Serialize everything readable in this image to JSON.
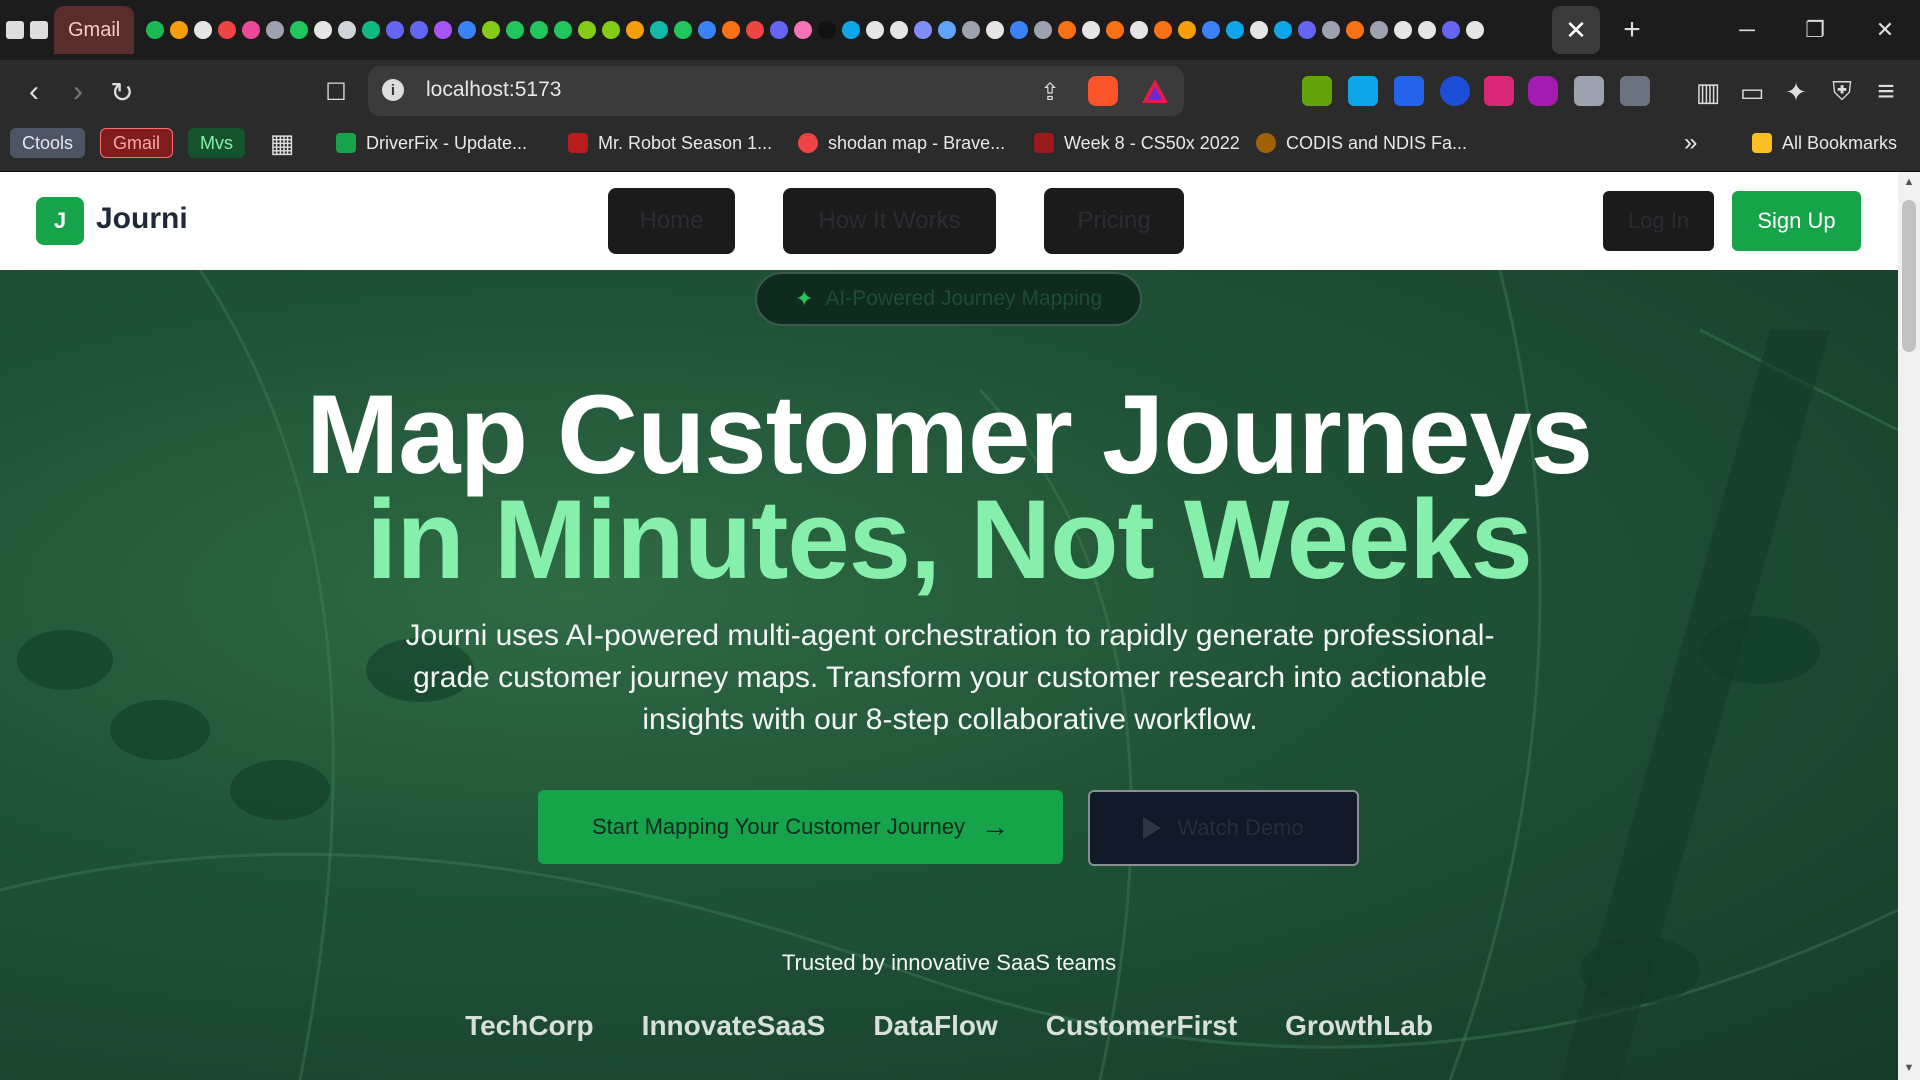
{
  "browser": {
    "active_tab_title": "Gmail",
    "url": "localhost:5173",
    "bookmarks": {
      "chips": [
        "Ctools",
        "Gmail",
        "Mvs"
      ],
      "items": [
        "DriverFix - Update...",
        "Mr. Robot Season 1...",
        "shodan map - Brave...",
        "Week 8 - CS50x 2022",
        "CODIS and NDIS Fa..."
      ],
      "overflow": "»",
      "all_bookmarks": "All Bookmarks"
    },
    "icons": {
      "new_tab": "+",
      "close_tab": "✕",
      "minimize": "─",
      "restore": "❐",
      "close_window": "✕",
      "back": "‹",
      "forward": "›",
      "reload": "↻",
      "bookmark": "☐",
      "info": "i",
      "share": "⇪",
      "apps": "▦",
      "sidebar": "▥",
      "wallet": "▭",
      "leo": "✦",
      "vpn": "⛨",
      "menu": "≡"
    }
  },
  "site": {
    "logo_letter": "J",
    "brand": "Journi",
    "nav": [
      "Home",
      "How It Works",
      "Pricing"
    ],
    "login": "Log In",
    "signup": "Sign Up"
  },
  "hero": {
    "badge": "AI-Powered Journey Mapping",
    "headline_line1": "Map Customer Journeys",
    "headline_line2": "in Minutes, Not Weeks",
    "subtext": "Journi uses AI-powered multi-agent orchestration to rapidly generate professional-grade customer journey maps. Transform your customer research into actionable insights with our 8-step collaborative workflow.",
    "cta_primary": "Start Mapping Your Customer Journey",
    "cta_arrow": "→",
    "cta_secondary": "Watch Demo",
    "trusted": "Trusted by innovative SaaS teams",
    "companies": [
      "TechCorp",
      "InnovateSaaS",
      "DataFlow",
      "CustomerFirst",
      "GrowthLab"
    ]
  },
  "colors": {
    "brand_green": "#16a34a",
    "headline_accent": "#86efac",
    "hero_bg": "#1f5135",
    "nav_button_bg": "#1b1b1b"
  }
}
